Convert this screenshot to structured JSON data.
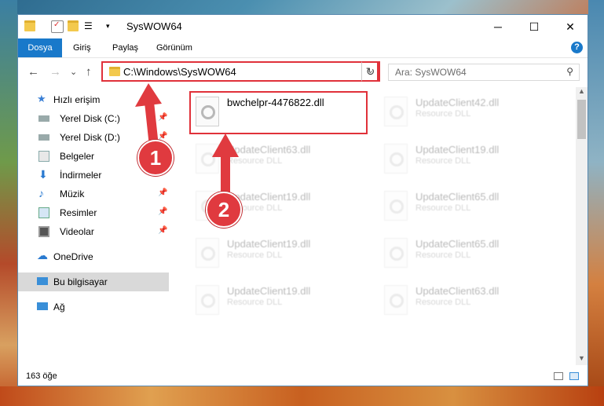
{
  "window": {
    "title": "SysWOW64"
  },
  "ribbon": {
    "tabs": [
      "Dosya",
      "Giriş",
      "Paylaş",
      "Görünüm"
    ],
    "help": "?"
  },
  "nav": {
    "back": "←",
    "forward": "→",
    "recent": "⌄",
    "up": "↑",
    "address": "C:\\Windows\\SysWOW64",
    "refresh": "↻",
    "search_placeholder": "Ara: SysWOW64"
  },
  "sidebar": {
    "items": [
      {
        "label": "Hızlı erişim",
        "icon": "star-icon"
      },
      {
        "label": "Yerel Disk (C:)",
        "icon": "drive-icon"
      },
      {
        "label": "Yerel Disk (D:)",
        "icon": "drive-icon"
      },
      {
        "label": "Belgeler",
        "icon": "documents-icon"
      },
      {
        "label": "İndirmeler",
        "icon": "download-icon"
      },
      {
        "label": "Müzik",
        "icon": "music-icon"
      },
      {
        "label": "Resimler",
        "icon": "pictures-icon"
      },
      {
        "label": "Videolar",
        "icon": "video-icon"
      },
      {
        "label": "OneDrive",
        "icon": "cloud-icon"
      },
      {
        "label": "Bu bilgisayar",
        "icon": "computer-icon"
      },
      {
        "label": "Ağ",
        "icon": "network-icon"
      }
    ]
  },
  "files": [
    {
      "name": "bwchelpr-4476822.dll",
      "type": ""
    },
    {
      "name": "UpdateClient42.dll",
      "type": "Resource DLL"
    },
    {
      "name": "UpdateClient63.dll",
      "type": "Resource DLL"
    },
    {
      "name": "UpdateClient19.dll",
      "type": "Resource DLL"
    },
    {
      "name": "UpdateClient19.dll",
      "type": "Resource DLL"
    },
    {
      "name": "UpdateClient65.dll",
      "type": "Resource DLL"
    },
    {
      "name": "UpdateClient19.dll",
      "type": "Resource DLL"
    },
    {
      "name": "UpdateClient65.dll",
      "type": "Resource DLL"
    },
    {
      "name": "UpdateClient19.dll",
      "type": "Resource DLL"
    },
    {
      "name": "UpdateClient63.dll",
      "type": "Resource DLL"
    }
  ],
  "status": {
    "count": "163 öğe"
  },
  "callouts": [
    "1",
    "2"
  ],
  "colors": {
    "accent": "#1979ca",
    "highlight": "#e0313a",
    "callout": "#e03a3f"
  }
}
